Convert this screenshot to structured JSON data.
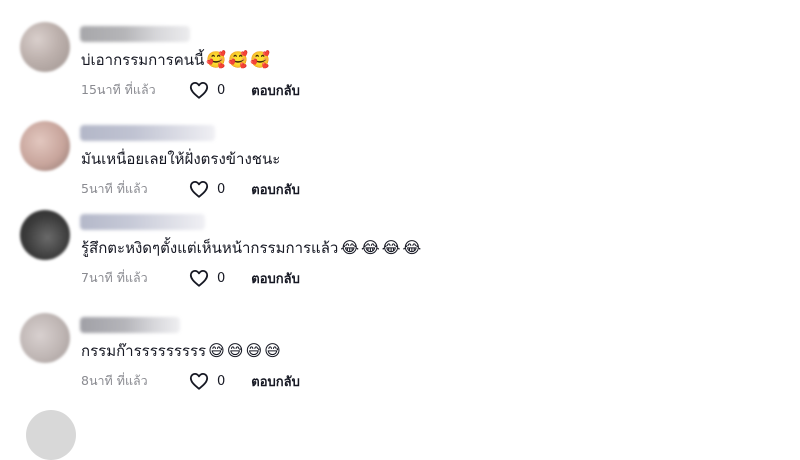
{
  "comments": [
    {
      "username": "",
      "text": "บ่เอากรรมการคนนี้",
      "emojis": [
        "🥰",
        "🥰",
        "🥰"
      ],
      "time": "15นาที ที่แล้ว",
      "likes": "0",
      "reply_label": "ตอบกลับ"
    },
    {
      "username": "",
      "text": "มันเหนื่อยเลยให้ฝั่งตรงข้างชนะ",
      "emojis": [],
      "time": "5นาที ที่แล้ว",
      "likes": "0",
      "reply_label": "ตอบกลับ"
    },
    {
      "username": "",
      "text": "รู้สึกตะหงิดๆตั้งแต่เห็นหน้ากรรมการแล้ว",
      "emojis": [
        "😂",
        "😂",
        "😂",
        "😂"
      ],
      "time": "7นาที ที่แล้ว",
      "likes": "0",
      "reply_label": "ตอบกลับ"
    },
    {
      "username": "",
      "text": "กรรมก๊ารรรรรรรรร",
      "emojis": [
        "😅",
        "😅",
        "😅",
        "😅"
      ],
      "time": "8นาที ที่แล้ว",
      "likes": "0",
      "reply_label": "ตอบกลับ"
    }
  ],
  "icons": {
    "like": "heart-outline-icon"
  }
}
